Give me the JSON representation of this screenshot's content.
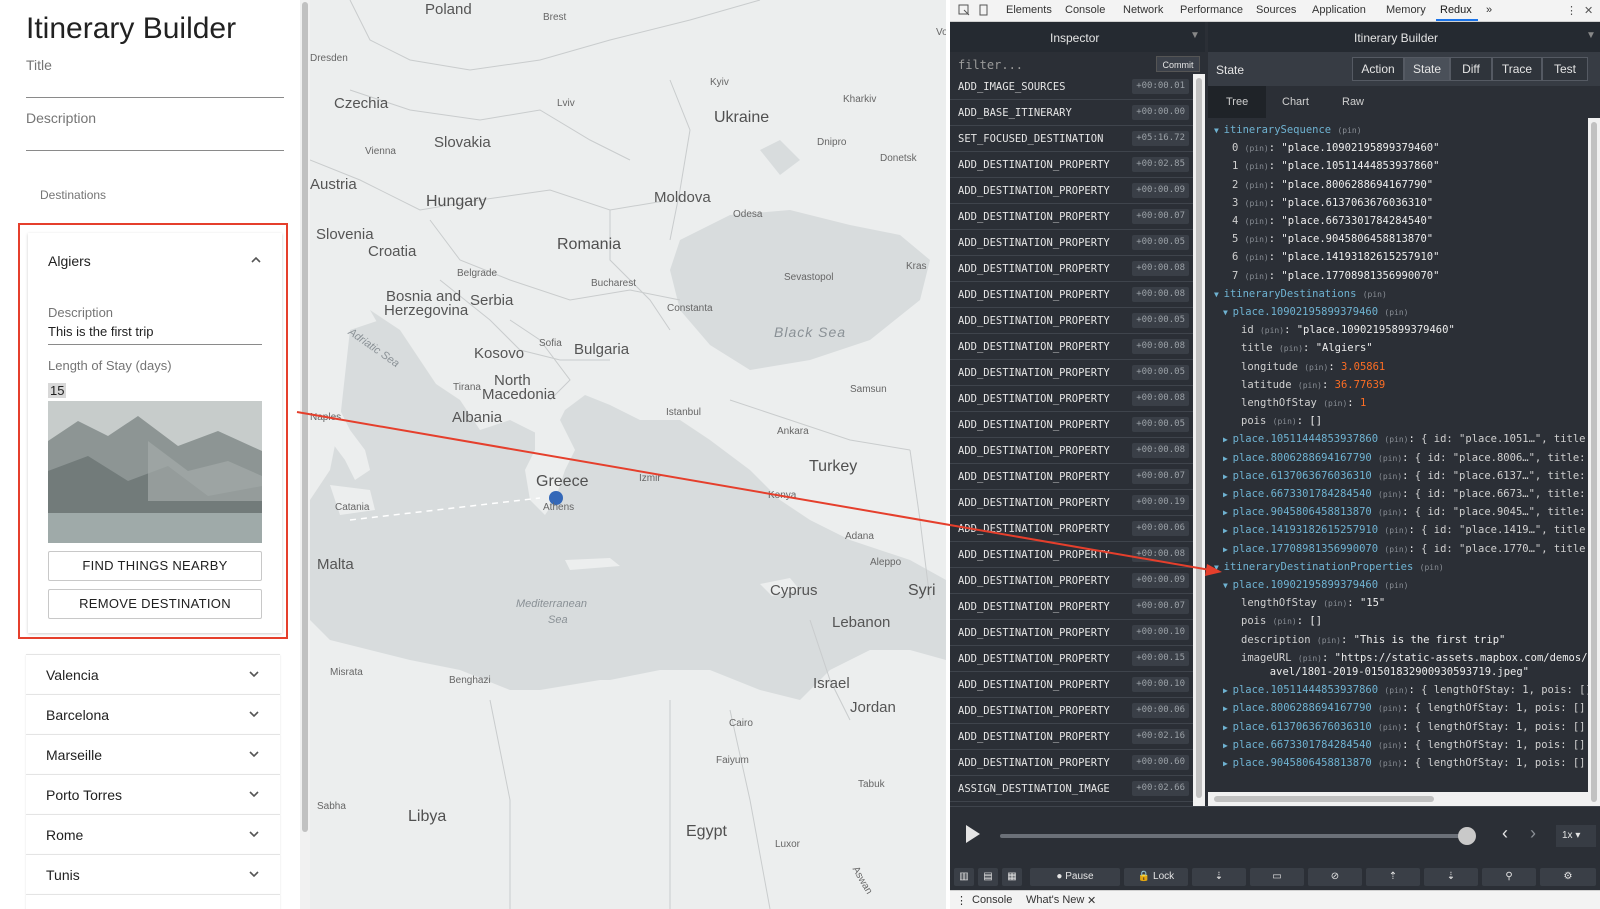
{
  "app": {
    "title": "Itinerary Builder",
    "title_label": "Title",
    "description_label": "Description",
    "destinations_header": "Destinations",
    "open_destination": {
      "name": "Algiers",
      "description_label": "Description",
      "description_value": "This is the first trip",
      "length_label": "Length of Stay (days)",
      "length_value": "15",
      "find_button": "FIND THINGS NEARBY",
      "remove_button": "REMOVE DESTINATION"
    },
    "destinations": [
      "Valencia",
      "Barcelona",
      "Marseille",
      "Porto Torres",
      "Rome",
      "Tunis"
    ]
  },
  "map": {
    "labels": {
      "poland": "Poland",
      "ukraine": "Ukraine",
      "czechia": "Czechia",
      "slovakia": "Slovakia",
      "austria": "Austria",
      "hungary": "Hungary",
      "moldova": "Moldova",
      "romania": "Romania",
      "slovenia": "Slovenia",
      "croatia": "Croatia",
      "bosnia": "Bosnia and",
      "herzegovina": "Herzegovina",
      "serbia": "Serbia",
      "bulgaria": "Bulgaria",
      "kosovo": "Kosovo",
      "north": "North",
      "macedonia": "Macedonia",
      "albania": "Albania",
      "greece": "Greece",
      "turkey": "Turkey",
      "black_sea": "Black Sea",
      "adriatic": "Adriatic Sea",
      "mediterranean": "Mediterranean",
      "sea": "Sea",
      "malta": "Malta",
      "libya": "Libya",
      "egypt": "Egypt",
      "cyprus": "Cyprus",
      "syria": "Syri",
      "israel": "Israel",
      "jordan": "Jordan",
      "lebanon": "Lebanon",
      "krasnodar": "Kras",
      "brest": "Brest",
      "kyiv": "Kyiv",
      "lviv": "Lviv",
      "kharkiv": "Kharkiv",
      "dnipro": "Dnipro",
      "donetsk": "Donetsk",
      "vienna": "Vienna",
      "bucharest": "Bucharest",
      "belgrade": "Belgrade",
      "sofia": "Sofia",
      "istanbul": "Istanbul",
      "ankara": "Ankara",
      "samsun": "Samsun",
      "konya": "Konya",
      "adana": "Adana",
      "aleppo": "Aleppo",
      "izmir": "Izmir",
      "athens": "Athens",
      "naples": "Naples",
      "catania": "Catania",
      "tirana": "Tirana",
      "constanta": "Constanta",
      "sevastopol": "Sevastopol",
      "misrata": "Misrata",
      "benghazi": "Benghazi",
      "cairo": "Cairo",
      "faiyum": "Faiyum",
      "luxor": "Luxor",
      "tabuk": "Tabuk",
      "sabha": "Sabha",
      "aswan": "Aswan",
      "odesa": "Odesa",
      "dresden": "Dresden",
      "vo": "Vo"
    }
  },
  "devtools": {
    "tabs": [
      "Elements",
      "Console",
      "Network",
      "Performance",
      "Sources",
      "Application",
      "Memory",
      "Redux"
    ],
    "more": "»",
    "inspector_title": "Inspector",
    "store_title": "Itinerary Builder",
    "filter_placeholder": "filter...",
    "commit": "Commit",
    "actions": [
      {
        "name": "ADD_IMAGE_SOURCES",
        "time": "+00:00.01"
      },
      {
        "name": "ADD_BASE_ITINERARY",
        "time": "+00:00.00"
      },
      {
        "name": "SET_FOCUSED_DESTINATION",
        "time": "+05:16.72"
      },
      {
        "name": "ADD_DESTINATION_PROPERTY",
        "time": "+00:02.85"
      },
      {
        "name": "ADD_DESTINATION_PROPERTY",
        "time": "+00:00.09"
      },
      {
        "name": "ADD_DESTINATION_PROPERTY",
        "time": "+00:00.07"
      },
      {
        "name": "ADD_DESTINATION_PROPERTY",
        "time": "+00:00.05"
      },
      {
        "name": "ADD_DESTINATION_PROPERTY",
        "time": "+00:00.08"
      },
      {
        "name": "ADD_DESTINATION_PROPERTY",
        "time": "+00:00.08"
      },
      {
        "name": "ADD_DESTINATION_PROPERTY",
        "time": "+00:00.05"
      },
      {
        "name": "ADD_DESTINATION_PROPERTY",
        "time": "+00:00.08"
      },
      {
        "name": "ADD_DESTINATION_PROPERTY",
        "time": "+00:00.05"
      },
      {
        "name": "ADD_DESTINATION_PROPERTY",
        "time": "+00:00.08"
      },
      {
        "name": "ADD_DESTINATION_PROPERTY",
        "time": "+00:00.05"
      },
      {
        "name": "ADD_DESTINATION_PROPERTY",
        "time": "+00:00.08"
      },
      {
        "name": "ADD_DESTINATION_PROPERTY",
        "time": "+00:00.07"
      },
      {
        "name": "ADD_DESTINATION_PROPERTY",
        "time": "+00:00.19"
      },
      {
        "name": "ADD_DESTINATION_PROPERTY",
        "time": "+00:00.06"
      },
      {
        "name": "ADD_DESTINATION_PROPERTY",
        "time": "+00:00.08"
      },
      {
        "name": "ADD_DESTINATION_PROPERTY",
        "time": "+00:00.09"
      },
      {
        "name": "ADD_DESTINATION_PROPERTY",
        "time": "+00:00.07"
      },
      {
        "name": "ADD_DESTINATION_PROPERTY",
        "time": "+00:00.10"
      },
      {
        "name": "ADD_DESTINATION_PROPERTY",
        "time": "+00:00.15"
      },
      {
        "name": "ADD_DESTINATION_PROPERTY",
        "time": "+00:00.10"
      },
      {
        "name": "ADD_DESTINATION_PROPERTY",
        "time": "+00:00.06"
      },
      {
        "name": "ADD_DESTINATION_PROPERTY",
        "time": "+00:02.16"
      },
      {
        "name": "ADD_DESTINATION_PROPERTY",
        "time": "+00:00.60"
      },
      {
        "name": "ASSIGN_DESTINATION_IMAGE",
        "time": "+00:02.66"
      }
    ],
    "state_label": "State",
    "modes": [
      "Action",
      "State",
      "Diff",
      "Trace",
      "Test"
    ],
    "subtabs": [
      "Tree",
      "Chart",
      "Raw"
    ],
    "pin": "(pin)",
    "tree": {
      "seq_key": "itinerarySequence",
      "sequence": [
        "\"place.10902195899379460\"",
        "\"place.10511444853937860\"",
        "\"place.8006288694167790\"",
        "\"place.6137063676036310\"",
        "\"place.6673301784284540\"",
        "\"place.9045806458813870\"",
        "\"place.14193182615257910\"",
        "\"place.17708981356990070\""
      ],
      "dest_key": "itineraryDestinations",
      "dest_open_key": "place.10902195899379460",
      "dest_fields": [
        {
          "k": "id",
          "v": "\"place.10902195899379460\"",
          "t": "s"
        },
        {
          "k": "title",
          "v": "\"Algiers\"",
          "t": "s"
        },
        {
          "k": "longitude",
          "v": "3.05861",
          "t": "n"
        },
        {
          "k": "latitude",
          "v": "36.77639",
          "t": "n"
        },
        {
          "k": "lengthOfStay",
          "v": "1",
          "t": "n"
        },
        {
          "k": "pois",
          "v": "[]",
          "t": "s"
        }
      ],
      "dest_collapsed": [
        {
          "k": "place.10511444853937860",
          "v": "{ id: \"place.1051…\", title: \"V"
        },
        {
          "k": "place.8006288694167790",
          "v": "{ id: \"place.8006…\", title: \"B"
        },
        {
          "k": "place.6137063676036310",
          "v": "{ id: \"place.6137…\", title: \"M"
        },
        {
          "k": "place.6673301784284540",
          "v": "{ id: \"place.6673…\", title: \"P"
        },
        {
          "k": "place.9045806458813870",
          "v": "{ id: \"place.9045…\", title: \"R"
        },
        {
          "k": "place.14193182615257910",
          "v": "{ id: \"place.1419…\", title: \""
        },
        {
          "k": "place.17708981356990070",
          "v": "{ id: \"place.1770…\", title: \""
        }
      ],
      "props_key": "itineraryDestinationProperties",
      "props_open_key": "place.10902195899379460",
      "props_fields": [
        {
          "k": "lengthOfStay",
          "v": "\"15\"",
          "t": "s"
        },
        {
          "k": "pois",
          "v": "[]",
          "t": "s"
        },
        {
          "k": "description",
          "v": "\"This is the first trip\"",
          "t": "s"
        },
        {
          "k": "imageURL",
          "v": "\"https://static-assets.mapbox.com/demos/tr",
          "t": "s"
        }
      ],
      "image_url_cont": "avel/1801-2019-01501832900930593719.jpeg\"",
      "props_collapsed": [
        {
          "k": "place.10511444853937860",
          "v": "{ lengthOfStay: 1, pois: [] }"
        },
        {
          "k": "place.8006288694167790",
          "v": "{ lengthOfStay: 1, pois: [] }"
        },
        {
          "k": "place.6137063676036310",
          "v": "{ lengthOfStay: 1, pois: [] }"
        },
        {
          "k": "place.6673301784284540",
          "v": "{ lengthOfStay: 1, pois: [] }"
        },
        {
          "k": "place.9045806458813870",
          "v": "{ lengthOfStay: 1, pois: [] }"
        }
      ]
    },
    "speed": "1x",
    "toolbar": {
      "pause": "Pause",
      "lock": "Lock"
    },
    "drawer": [
      "Console",
      "What's New"
    ]
  },
  "colors": {
    "highlight": "#e53f2c",
    "marker": "#3468b8",
    "key": "#6fb3d2",
    "number": "#fc6d24"
  }
}
